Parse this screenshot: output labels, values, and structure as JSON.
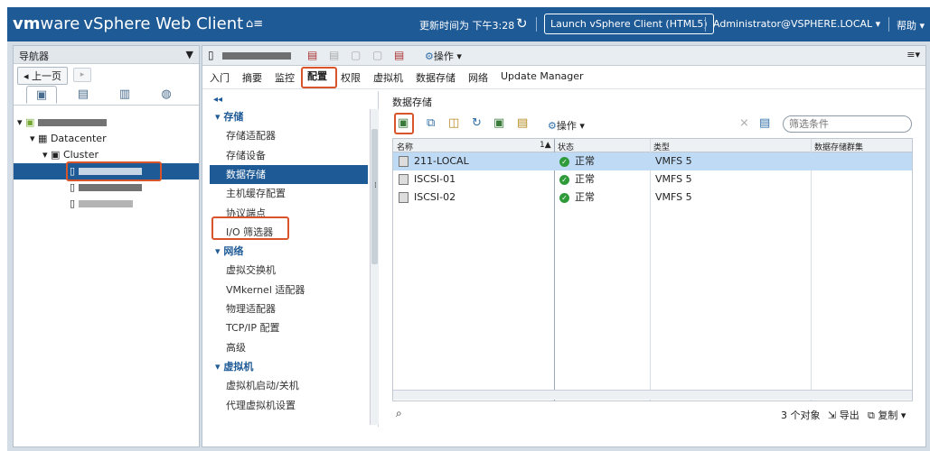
{
  "topbar": {
    "brand_vm": "vm",
    "brand_ware": "ware",
    "product": "vSphere Web Client",
    "home_icon": "home-icon",
    "update_time": "更新时间为 下午3:28",
    "launch_button": "Launch vSphere Client (HTML5)",
    "user": "Administrator@VSPHERE.LOCAL ▾",
    "help": "帮助 ▾"
  },
  "navigator": {
    "title": "导航器",
    "back_label": "◂ 上一页",
    "tree": {
      "datacenter": "Datacenter",
      "cluster": "Cluster"
    }
  },
  "main": {
    "actions_label": "操作 ▾",
    "tabs": [
      "入门",
      "摘要",
      "监控",
      "配置",
      "权限",
      "虚拟机",
      "数据存储",
      "网络",
      "Update Manager"
    ],
    "active_tab": "配置",
    "collapse": "◂◂",
    "menu": [
      {
        "label": "▾ 存储",
        "type": "cat"
      },
      {
        "label": "存储适配器",
        "type": "item"
      },
      {
        "label": "存储设备",
        "type": "item"
      },
      {
        "label": "数据存储",
        "type": "item"
      },
      {
        "label": "主机缓存配置",
        "type": "item"
      },
      {
        "label": "协议端点",
        "type": "item"
      },
      {
        "label": "I/O 筛选器",
        "type": "item"
      },
      {
        "label": "▾ 网络",
        "type": "cat"
      },
      {
        "label": "虚拟交换机",
        "type": "item"
      },
      {
        "label": "VMkernel 适配器",
        "type": "item"
      },
      {
        "label": "物理适配器",
        "type": "item"
      },
      {
        "label": "TCP/IP 配置",
        "type": "item"
      },
      {
        "label": "高级",
        "type": "item"
      },
      {
        "label": "▾ 虚拟机",
        "type": "cat"
      },
      {
        "label": "虚拟机启动/关机",
        "type": "item"
      },
      {
        "label": "代理虚拟机设置",
        "type": "item"
      }
    ],
    "selected_menu": "数据存储"
  },
  "datastore": {
    "title": "数据存储",
    "actions_label": "操作 ▾",
    "filter_placeholder": "筛选条件",
    "columns": [
      "名称",
      "状态",
      "类型",
      "数据存储群集"
    ],
    "sort_indicator": "1▲",
    "rows": [
      {
        "name": "211-LOCAL",
        "status": "正常",
        "type": "VMFS 5",
        "cluster": ""
      },
      {
        "name": "ISCSI-01",
        "status": "正常",
        "type": "VMFS 5",
        "cluster": ""
      },
      {
        "name": "ISCSI-02",
        "status": "正常",
        "type": "VMFS 5",
        "cluster": ""
      }
    ],
    "count": "3 个对象",
    "export": "导出",
    "copy": "复制 ▾"
  },
  "colors": {
    "topbar": "#1e5a96",
    "selection": "#1e5a96",
    "highlight": "#d9542b",
    "status_ok": "#2f9a3a"
  }
}
